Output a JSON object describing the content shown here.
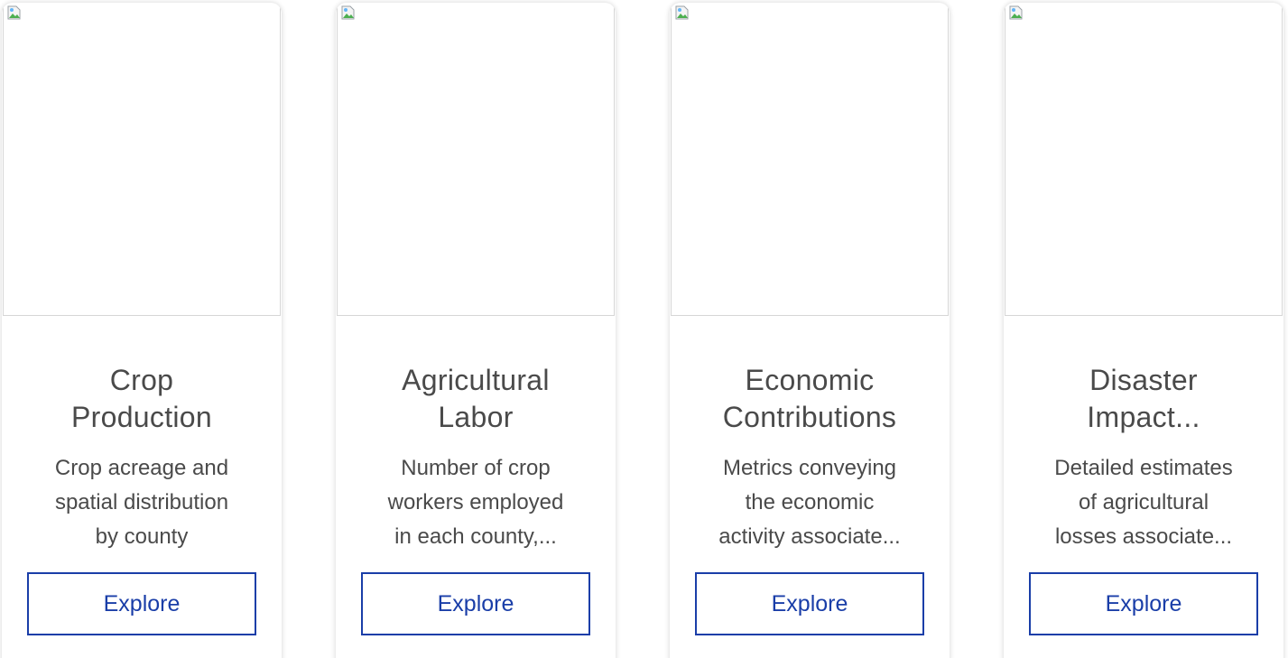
{
  "cards": [
    {
      "title_line1": "Crop",
      "title_line2": "Production",
      "desc_lines": [
        "Crop acreage and",
        "spatial distribution",
        "by county"
      ],
      "button_label": "Explore"
    },
    {
      "title_line1": "Agricultural",
      "title_line2": "Labor",
      "desc_lines": [
        "Number of crop",
        "workers employed",
        "in each county,..."
      ],
      "button_label": "Explore"
    },
    {
      "title_line1": "Economic",
      "title_line2": "Contributions",
      "desc_lines": [
        "Metrics conveying",
        "the economic",
        "activity associate..."
      ],
      "button_label": "Explore"
    },
    {
      "title_line1": "Disaster",
      "title_line2": "Impact...",
      "desc_lines": [
        "Detailed estimates",
        "of agricultural",
        "losses associate..."
      ],
      "button_label": "Explore"
    }
  ],
  "colors": {
    "button_border": "#1a3ea8",
    "text": "#4a4a4a"
  },
  "icons": {
    "image_placeholder": "broken-image-icon"
  }
}
